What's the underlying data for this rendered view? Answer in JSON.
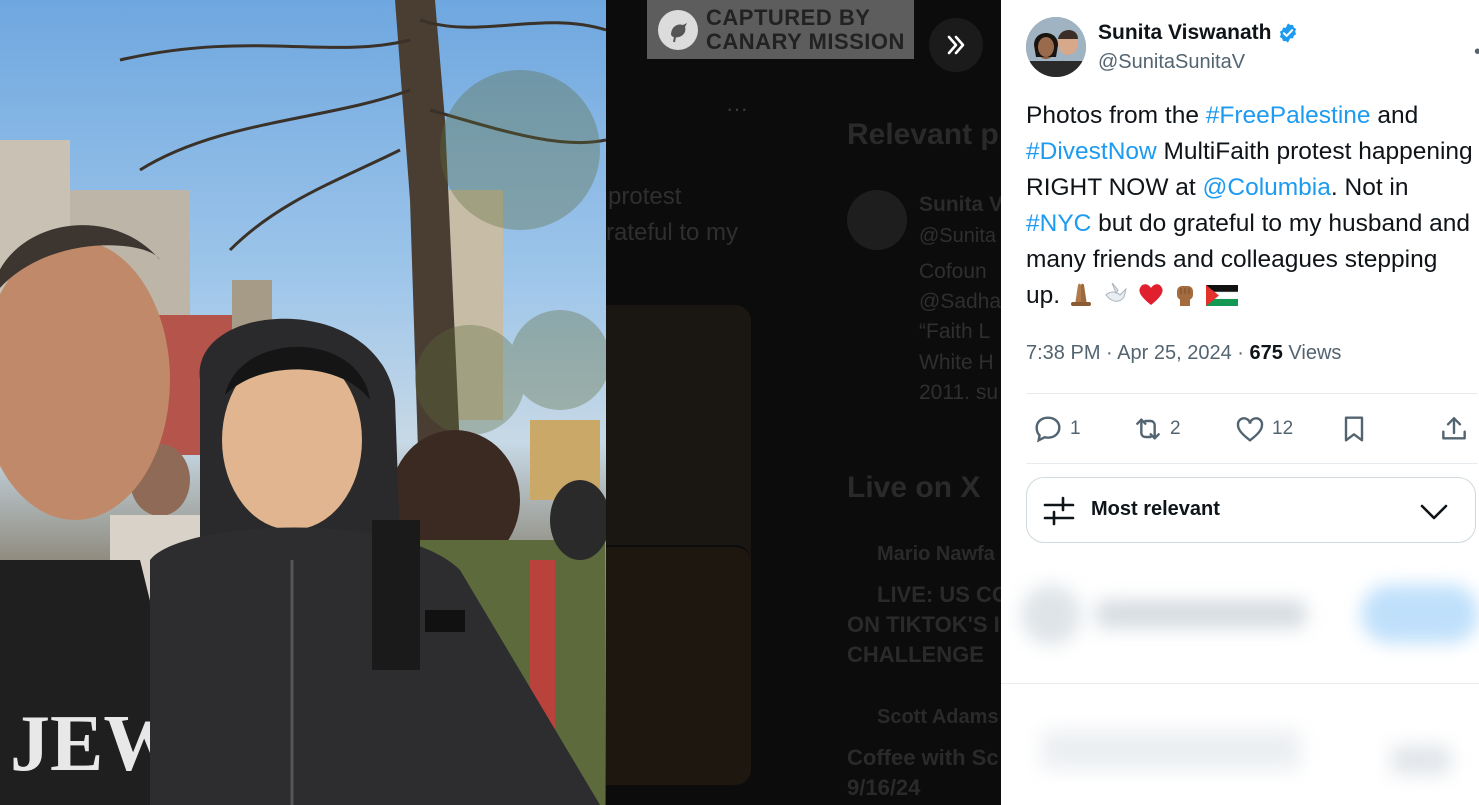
{
  "watermark": {
    "line1": "CAPTURED BY",
    "line2": "CANARY MISSION"
  },
  "backdrop": {
    "more": "···",
    "frag_protest": "protest",
    "frag_grateful": "rateful to my",
    "relevant_heading": "Relevant p",
    "user_name_frag": "Sunita V",
    "user_handle_frag": "@Sunita",
    "bio_line1": "Cofoun",
    "bio_line2": "@Sadha",
    "bio_line3": "“Faith L",
    "bio_line4": "White H",
    "bio_line5": "2011. su",
    "live_heading": "Live on X",
    "live1_user": "Mario Nawfa",
    "live1_line1": "LIVE: US CO",
    "live1_line2": "ON TIKTOK'S I",
    "live1_line3": "CHALLENGE",
    "live2_user": "Scott Adams",
    "live2_line1": "Coffee with Sc",
    "live2_line2": "9/16/24"
  },
  "tweet": {
    "author_name": "Sunita Viswanath",
    "author_handle": "@SunitaSunitaV",
    "text": {
      "t1": "Photos from the ",
      "tag1": "#FreePalestine",
      "t2": "  and",
      "tag2": "#DivestNow",
      "t3": " MultiFaith protest happening RIGHT NOW at ",
      "mention": "@Columbia",
      "t4": ". Not in ",
      "tag3": "#NYC",
      "t5": " but do grateful to my husband and many friends and colleagues stepping up."
    },
    "time": "7:38 PM",
    "date": "Apr 25, 2024",
    "sep": " · ",
    "views_count": "675",
    "views_label": " Views",
    "replies": "1",
    "reposts": "2",
    "likes": "12",
    "sort_label": "Most relevant"
  },
  "colors": {
    "link": "#1d9bf0",
    "verified": "#1d9bf0",
    "text": "#0f1419",
    "muted": "#536471"
  }
}
